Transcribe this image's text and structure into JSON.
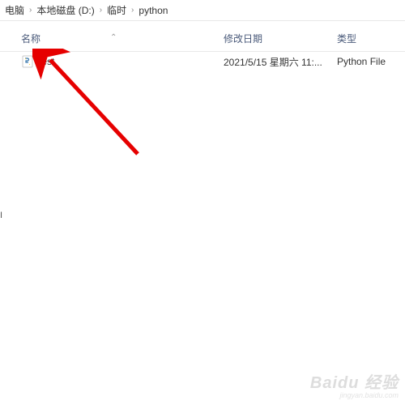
{
  "breadcrumb": {
    "items": [
      "电脑",
      "本地磁盘 (D:)",
      "临时",
      "python"
    ]
  },
  "columns": {
    "name": "名称",
    "date": "修改日期",
    "type": "类型"
  },
  "files": [
    {
      "name": "test",
      "date": "2021/5/15 星期六 11:...",
      "type": "Python File"
    }
  ],
  "watermark": {
    "logo": "Baidu 经验",
    "sub": "jingyan.baidu.com"
  }
}
